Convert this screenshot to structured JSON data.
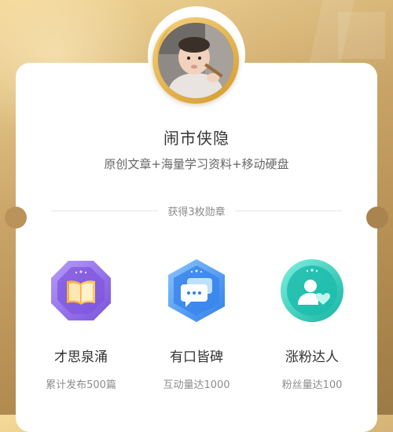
{
  "profile": {
    "name": "闹市侠隐",
    "tagline": "原创文章+海量学习资料+移动硬盘"
  },
  "medals": {
    "summary": "获得3枚勋章",
    "items": [
      {
        "title": "才思泉涌",
        "desc": "累计发布500篇",
        "icon": "book-icon",
        "color": "#8a63e8"
      },
      {
        "title": "有口皆碑",
        "desc": "互动量达1000",
        "icon": "chat-bubbles-icon",
        "color": "#3d8ef0"
      },
      {
        "title": "涨粉达人",
        "desc": "粉丝量达100",
        "icon": "user-heart-icon",
        "color": "#26c6b6"
      }
    ]
  },
  "colors": {
    "background_gold": "#c9a468",
    "card": "#ffffff",
    "avatar_ring": "#e0ad45"
  }
}
